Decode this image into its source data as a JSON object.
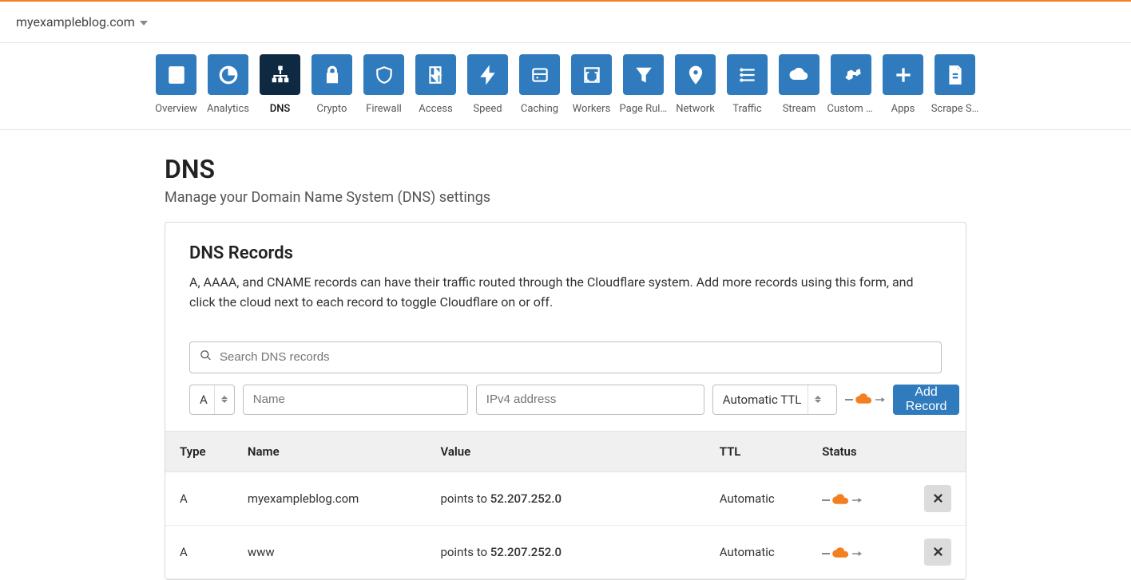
{
  "domain": "myexampleblog.com",
  "nav": [
    {
      "id": "overview",
      "label": "Overview"
    },
    {
      "id": "analytics",
      "label": "Analytics"
    },
    {
      "id": "dns",
      "label": "DNS",
      "active": true
    },
    {
      "id": "crypto",
      "label": "Crypto"
    },
    {
      "id": "firewall",
      "label": "Firewall"
    },
    {
      "id": "access",
      "label": "Access"
    },
    {
      "id": "speed",
      "label": "Speed"
    },
    {
      "id": "caching",
      "label": "Caching"
    },
    {
      "id": "workers",
      "label": "Workers"
    },
    {
      "id": "pagerules",
      "label": "Page Rules"
    },
    {
      "id": "network",
      "label": "Network"
    },
    {
      "id": "traffic",
      "label": "Traffic"
    },
    {
      "id": "stream",
      "label": "Stream"
    },
    {
      "id": "customp",
      "label": "Custom P…"
    },
    {
      "id": "apps",
      "label": "Apps"
    },
    {
      "id": "scrape",
      "label": "Scrape S…"
    }
  ],
  "page": {
    "title": "DNS",
    "subtitle": "Manage your Domain Name System (DNS) settings"
  },
  "records_card": {
    "heading": "DNS Records",
    "description": "A, AAAA, and CNAME records can have their traffic routed through the Cloudflare system. Add more records using this form, and click the cloud next to each record to toggle Cloudflare on or off.",
    "search_placeholder": "Search DNS records",
    "form": {
      "type_value": "A",
      "name_placeholder": "Name",
      "value_placeholder": "IPv4 address",
      "ttl_value": "Automatic TTL",
      "add_button": "Add Record"
    },
    "columns": {
      "type": "Type",
      "name": "Name",
      "value": "Value",
      "ttl": "TTL",
      "status": "Status"
    },
    "value_prefix": "points to ",
    "rows": [
      {
        "type": "A",
        "name": "myexampleblog.com",
        "value": "52.207.252.0",
        "ttl": "Automatic",
        "proxied": true
      },
      {
        "type": "A",
        "name": "www",
        "value": "52.207.252.0",
        "ttl": "Automatic",
        "proxied": true
      }
    ]
  },
  "colors": {
    "tile": "#2f7bbd",
    "tile_active": "#0e2a43",
    "cloud_orange": "#f38020",
    "btn_primary": "#2f7bbd"
  }
}
